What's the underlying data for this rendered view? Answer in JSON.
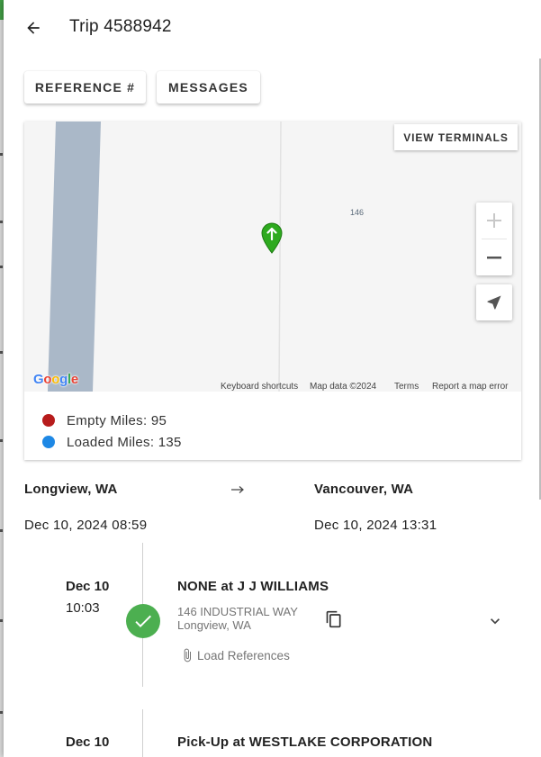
{
  "header": {
    "title": "Trip 4588942"
  },
  "actions": {
    "reference_label": "REFERENCE #",
    "messages_label": "MESSAGES"
  },
  "map": {
    "view_terminals_label": "VIEW TERMINALS",
    "road_label": "146",
    "attribution": {
      "keyboard_shortcuts": "Keyboard shortcuts",
      "map_data": "Map data ©2024",
      "terms": "Terms",
      "report": "Report a map error"
    },
    "marker_color": "#2eaa1f"
  },
  "legend": {
    "empty_miles": "Empty Miles: 95",
    "loaded_miles": "Loaded Miles: 135",
    "empty_color": "#b71c1c",
    "loaded_color": "#1e88e5"
  },
  "route": {
    "origin": "Longview, WA",
    "destination": "Vancouver, WA",
    "origin_datetime": "Dec 10, 2024 08:59",
    "destination_datetime": "Dec 10, 2024 13:31"
  },
  "stops": [
    {
      "date": "Dec 10",
      "time": "10:03",
      "title": "NONE at J J WILLIAMS",
      "address_line1": "146 INDUSTRIAL WAY",
      "address_line2": "Longview, WA",
      "load_refs_label": "Load References",
      "status": "completed"
    },
    {
      "date": "Dec 10",
      "title": "Pick-Up at WESTLAKE CORPORATION"
    }
  ]
}
